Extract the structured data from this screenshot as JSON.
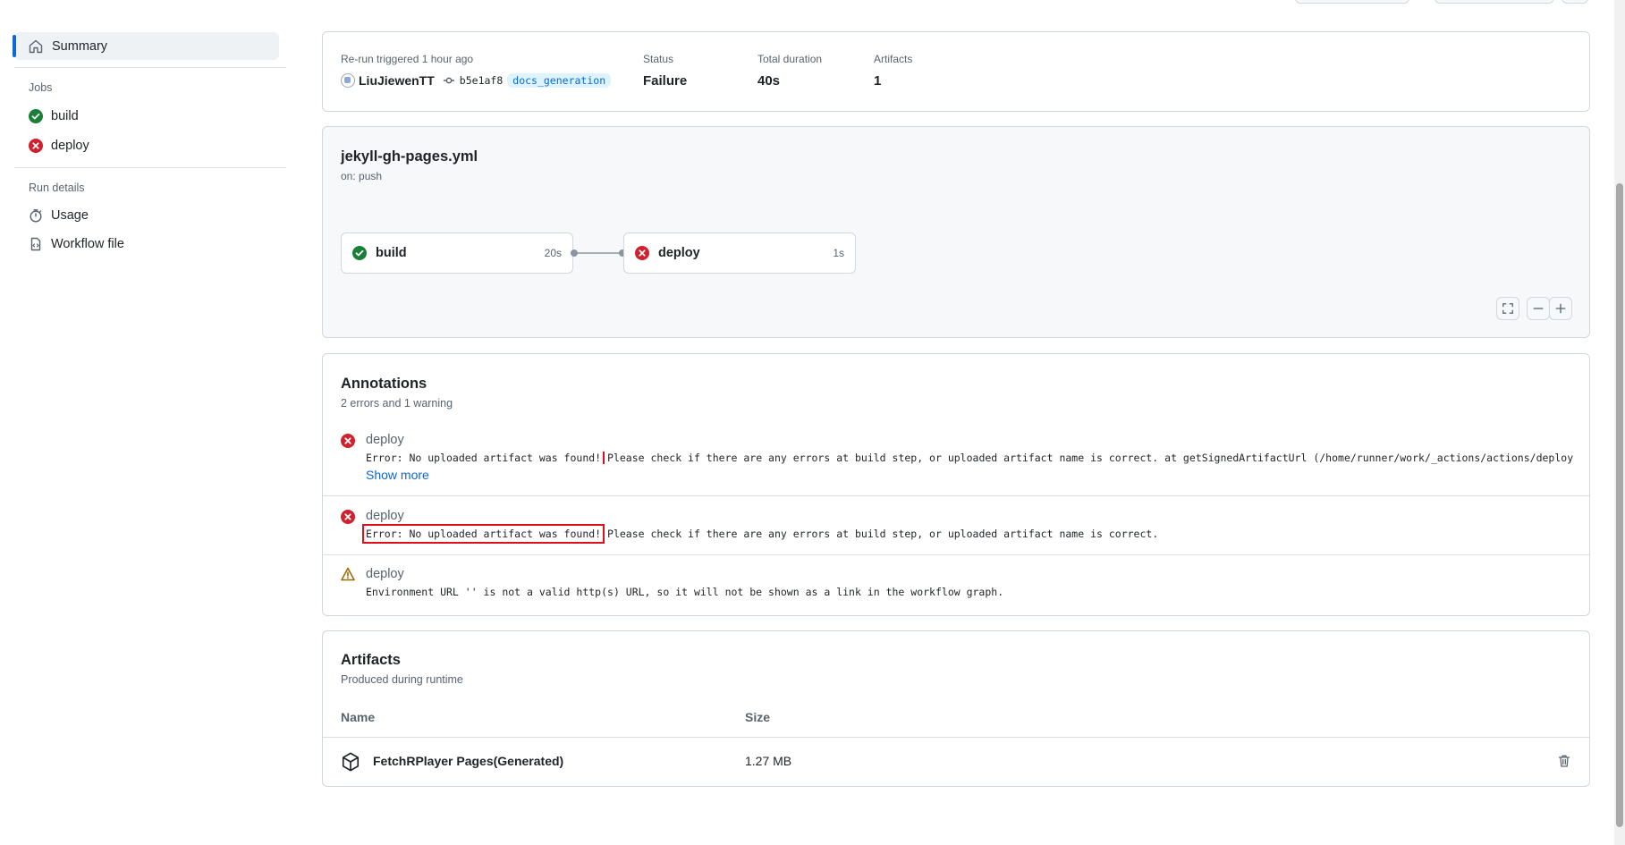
{
  "sidebar": {
    "summary_label": "Summary",
    "jobs_heading": "Jobs",
    "jobs": [
      {
        "label": "build",
        "status": "success"
      },
      {
        "label": "deploy",
        "status": "failure"
      }
    ],
    "run_details_heading": "Run details",
    "details": [
      {
        "label": "Usage",
        "icon": "stopwatch-icon"
      },
      {
        "label": "Workflow file",
        "icon": "file-code-icon"
      }
    ]
  },
  "run_info": {
    "trigger_text": "Re-run triggered 1 hour ago",
    "actor": "LiuJiewenTT",
    "commit": "b5e1af8",
    "branch": "docs_generation",
    "status_label": "Status",
    "status_value": "Failure",
    "duration_label": "Total duration",
    "duration_value": "40s",
    "artifacts_label": "Artifacts",
    "artifacts_value": "1"
  },
  "workflow": {
    "file_name": "jekyll-gh-pages.yml",
    "trigger": "on: push",
    "jobs": [
      {
        "name": "build",
        "duration": "20s",
        "status": "success"
      },
      {
        "name": "deploy",
        "duration": "1s",
        "status": "failure"
      }
    ]
  },
  "annotations": {
    "title": "Annotations",
    "subtitle": "2 errors and 1 warning",
    "items": [
      {
        "type": "error",
        "job": "deploy",
        "highlight": "Error: No uploaded artifact was found!",
        "message": " Please check if there are any errors at build step, or uploaded artifact name is correct. at getSignedArtifactUrl (/home/runner/work/_actions/actions/deploy-pages/v…",
        "show_more": "Show more"
      },
      {
        "type": "error",
        "job": "deploy",
        "highlight": "Error: No uploaded artifact was found!",
        "message": " Please check if there are any errors at build step, or uploaded artifact name is correct."
      },
      {
        "type": "warning",
        "job": "deploy",
        "message": "Environment URL '' is not a valid http(s) URL, so it will not be shown as a link in the workflow graph."
      }
    ]
  },
  "artifacts": {
    "title": "Artifacts",
    "subtitle": "Produced during runtime",
    "col_name": "Name",
    "col_size": "Size",
    "rows": [
      {
        "name": "FetchRPlayer Pages(Generated)",
        "size": "1.27 MB"
      }
    ]
  },
  "colors": {
    "success": "#1a7f37",
    "failure": "#cf222e",
    "warning": "#9a6700",
    "accent": "#0969da",
    "highlight_box": "#e0101a"
  }
}
